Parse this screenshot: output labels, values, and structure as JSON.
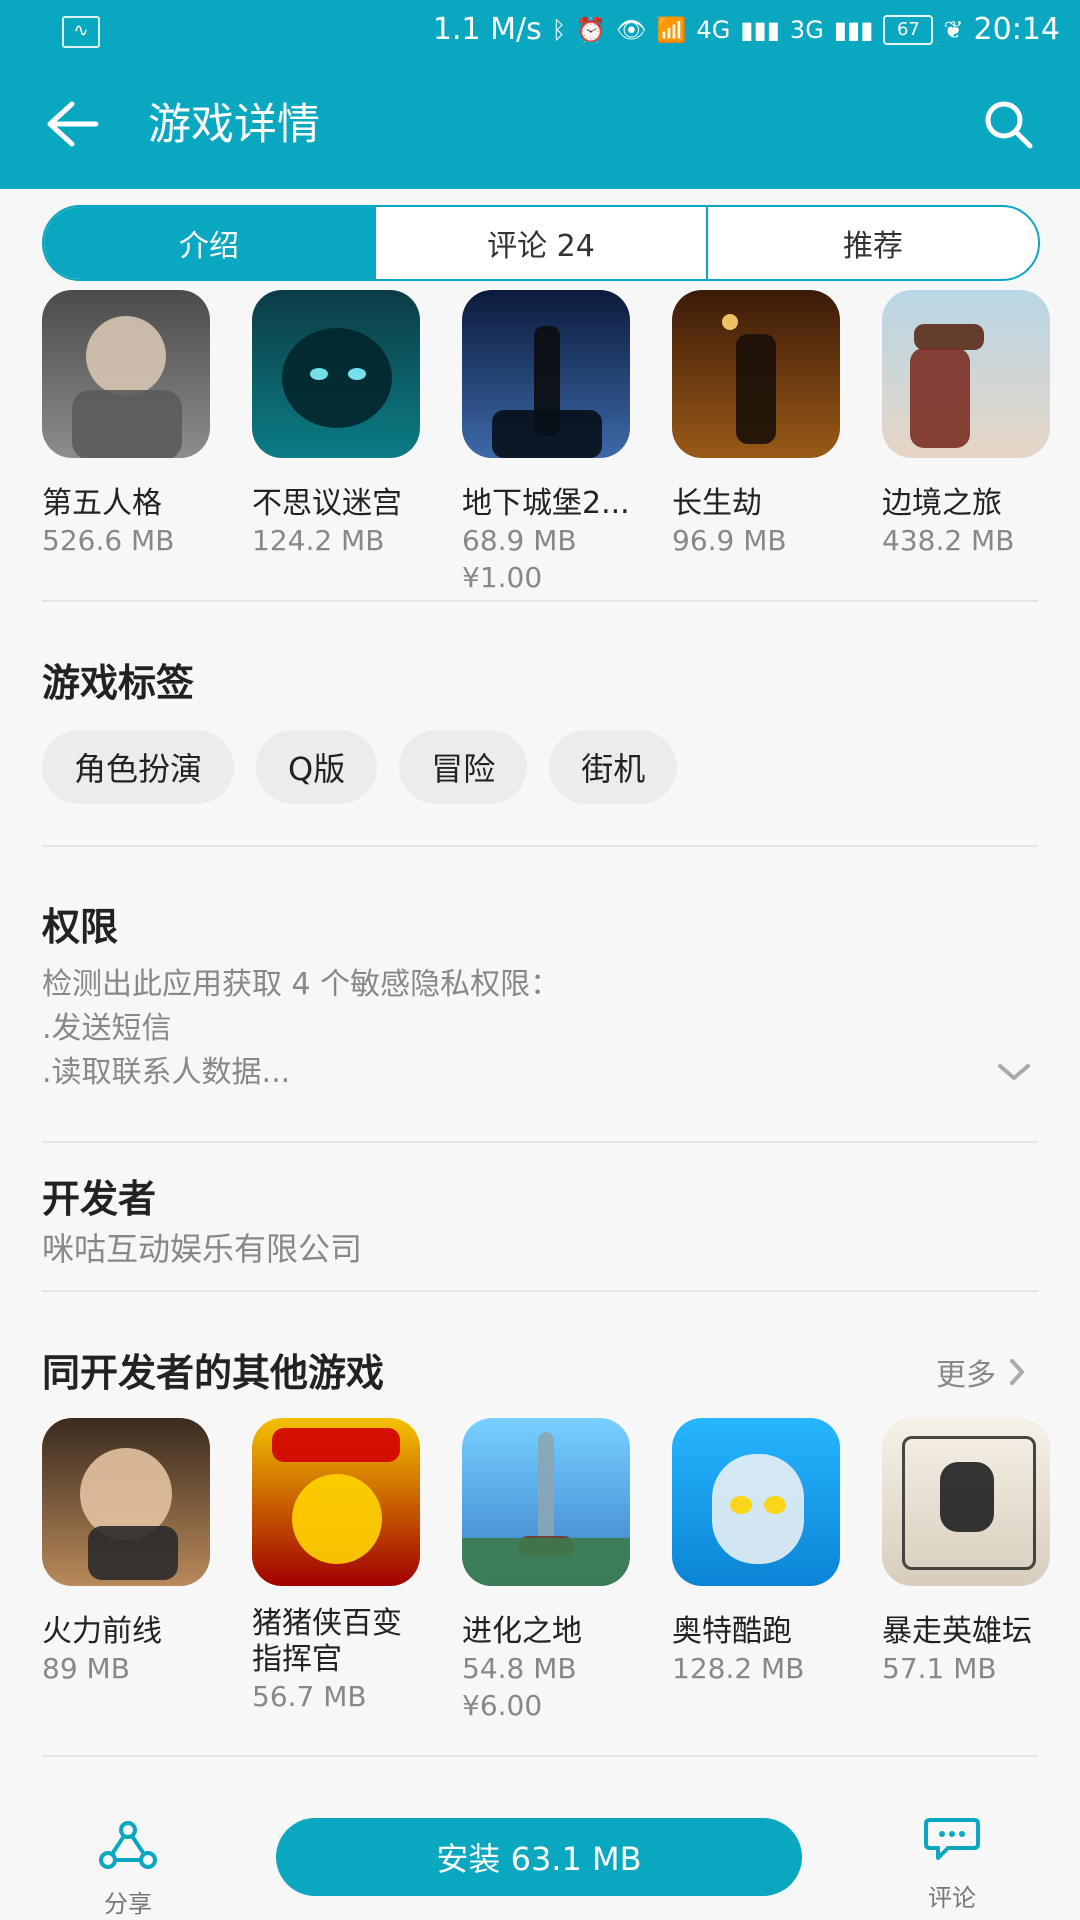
{
  "status": {
    "speed": "1.1 M/s",
    "net_4g": "4G",
    "net_3g": "3G",
    "battery": "67",
    "time": "20:14"
  },
  "header": {
    "title": "游戏详情"
  },
  "tabs": [
    {
      "label": "介绍"
    },
    {
      "label": "评论  24"
    },
    {
      "label": "推荐"
    }
  ],
  "related_games": [
    {
      "name": "第五人格",
      "size": "526.6 MB",
      "price": ""
    },
    {
      "name": "不思议迷宫",
      "size": "124.2 MB",
      "price": ""
    },
    {
      "name": "地下城堡2...",
      "size": "68.9 MB",
      "price": "¥1.00"
    },
    {
      "name": "长生劫",
      "size": "96.9 MB",
      "price": ""
    },
    {
      "name": "边境之旅",
      "size": "438.2 MB",
      "price": ""
    }
  ],
  "tags_section": {
    "title": "游戏标签",
    "tags": [
      "角色扮演",
      "Q版",
      "冒险",
      "街机"
    ]
  },
  "permissions": {
    "title": "权限",
    "lines": [
      "检测出此应用获取 4 个敏感隐私权限：",
      ".发送短信",
      ".读取联系人数据..."
    ]
  },
  "developer": {
    "title": "开发者",
    "name": "咪咕互动娱乐有限公司"
  },
  "same_dev": {
    "title": "同开发者的其他游戏",
    "more": "更多",
    "games": [
      {
        "name": "火力前线",
        "size": "89 MB",
        "price": ""
      },
      {
        "name": "猪猪侠百变指挥官",
        "size": "56.7 MB",
        "price": ""
      },
      {
        "name": "进化之地",
        "size": "54.8 MB",
        "price": "¥6.00"
      },
      {
        "name": "奥特酷跑",
        "size": "128.2 MB",
        "price": ""
      },
      {
        "name": "暴走英雄坛",
        "size": "57.1 MB",
        "price": ""
      }
    ]
  },
  "bottom": {
    "share": "分享",
    "install": "安装 63.1 MB",
    "comment": "评论"
  }
}
